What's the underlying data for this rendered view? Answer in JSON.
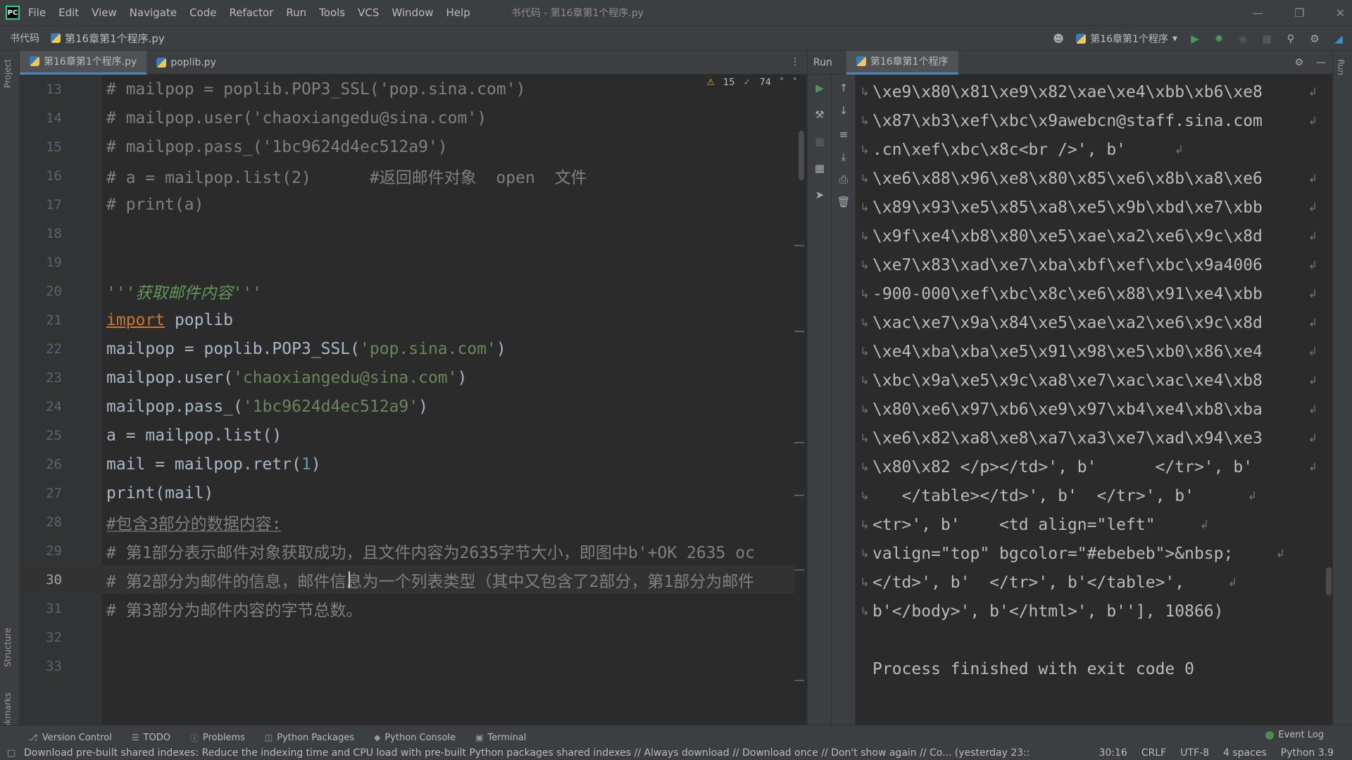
{
  "menubar": {
    "items": [
      "File",
      "Edit",
      "View",
      "Navigate",
      "Code",
      "Refactor",
      "Run",
      "Tools",
      "VCS",
      "Window",
      "Help"
    ],
    "window_title": "书代码 - 第16章第1个程序.py"
  },
  "navbar": {
    "project": "书代码",
    "file": "第16章第1个程序.py",
    "run_config": "第16章第1个程序"
  },
  "editor": {
    "tabs": [
      {
        "label": "第16章第1个程序.py",
        "active": true
      },
      {
        "label": "poplib.py",
        "active": false
      }
    ],
    "inspection": {
      "warnings": "15",
      "ok": "74"
    },
    "lines": [
      {
        "num": "13",
        "text": "# mailpop = poplib.POP3_SSL('pop.sina.com')"
      },
      {
        "num": "14",
        "text": "# mailpop.user('chaoxiangedu@sina.com')"
      },
      {
        "num": "15",
        "text": "# mailpop.pass_('1bc9624d4ec512a9')"
      },
      {
        "num": "16",
        "text": "# a = mailpop.list(2)      #返回邮件对象  open  文件"
      },
      {
        "num": "17",
        "text": "# print(a)"
      },
      {
        "num": "18",
        "text": ""
      },
      {
        "num": "19",
        "text": ""
      },
      {
        "num": "20",
        "text": "'''获取邮件内容'''"
      },
      {
        "num": "21",
        "kw": "import",
        "text": " poplib"
      },
      {
        "num": "22",
        "pre": "mailpop = poplib.POP3_SSL(",
        "str": "'pop.sina.com'",
        "post": ")"
      },
      {
        "num": "23",
        "pre": "mailpop.user(",
        "str": "'chaoxiangedu@sina.com'",
        "post": ")"
      },
      {
        "num": "24",
        "pre": "mailpop.pass_(",
        "str": "'1bc9624d4ec512a9'",
        "post": ")"
      },
      {
        "num": "25",
        "text": "a = mailpop.list()"
      },
      {
        "num": "26",
        "pre": "mail = mailpop.retr(",
        "num_lit": "1",
        "post": ")"
      },
      {
        "num": "27",
        "text": "print(mail)"
      },
      {
        "num": "28",
        "text": "#包含3部分的数据内容:"
      },
      {
        "num": "29",
        "text": "# 第1部分表示邮件对象获取成功，且文件内容为2635字节大小，即图中b'+OK 2635 oc"
      },
      {
        "num": "30",
        "text": "# 第2部分为邮件的信息，邮件信息为一个列表类型（其中又包含了2部分，第1部分为邮件"
      },
      {
        "num": "31",
        "text": "# 第3部分为邮件内容的字节总数。"
      },
      {
        "num": "32",
        "text": ""
      },
      {
        "num": "33",
        "text": ""
      }
    ]
  },
  "run": {
    "title": "Run",
    "tab": "第16章第1个程序",
    "console_lines": [
      "\\xe9\\x80\\x81\\xe9\\x82\\xae\\xe4\\xbb\\xb6\\xe8",
      "\\x87\\xb3\\xef\\xbc\\x9awebcn@staff.sina.com",
      ".cn\\xef\\xbc\\x8c<br />', b'",
      "\\xe6\\x88\\x96\\xe8\\x80\\x85\\xe6\\x8b\\xa8\\xe6",
      "\\x89\\x93\\xe5\\x85\\xa8\\xe5\\x9b\\xbd\\xe7\\xbb",
      "\\x9f\\xe4\\xb8\\x80\\xe5\\xae\\xa2\\xe6\\x9c\\x8d",
      "\\xe7\\x83\\xad\\xe7\\xba\\xbf\\xef\\xbc\\x9a4006",
      "-900-000\\xef\\xbc\\x8c\\xe6\\x88\\x91\\xe4\\xbb",
      "\\xac\\xe7\\x9a\\x84\\xe5\\xae\\xa2\\xe6\\x9c\\x8d",
      "\\xe4\\xba\\xba\\xe5\\x91\\x98\\xe5\\xb0\\x86\\xe4",
      "\\xbc\\x9a\\xe5\\x9c\\xa8\\xe7\\xac\\xac\\xe4\\xb8",
      "\\x80\\xe6\\x97\\xb6\\xe9\\x97\\xb4\\xe4\\xb8\\xba",
      "\\xe6\\x82\\xa8\\xe8\\xa7\\xa3\\xe7\\xad\\x94\\xe3",
      "\\x80\\x82 </p></td>', b'      </tr>', b'",
      "   </table></td>', b'  </tr>', b'",
      "<tr>', b'    <td align=\"left\"",
      "valign=\"top\" bgcolor=\"#ebebeb\">&nbsp;",
      "</td>', b'  </tr>', b'</table>',",
      "b'</body>', b'</html>', b''], 10866)",
      "",
      "Process finished with exit code 0"
    ]
  },
  "bottom_tabs": [
    "Version Control",
    "TODO",
    "Problems",
    "Python Packages",
    "Python Console",
    "Terminal"
  ],
  "event_log": "Event Log",
  "status": {
    "message": "Download pre-built shared indexes: Reduce the indexing time and CPU load with pre-built Python packages shared indexes // Always download // Download once // Don't show again // Co... (yesterday 23::",
    "position": "30:16",
    "line_sep": "CRLF",
    "encoding": "UTF-8",
    "indent": "4 spaces",
    "interpreter": "Python 3.9"
  },
  "left_strip": [
    "Project",
    "Structure",
    "Bookmarks"
  ],
  "right_strip": [
    "Run"
  ]
}
